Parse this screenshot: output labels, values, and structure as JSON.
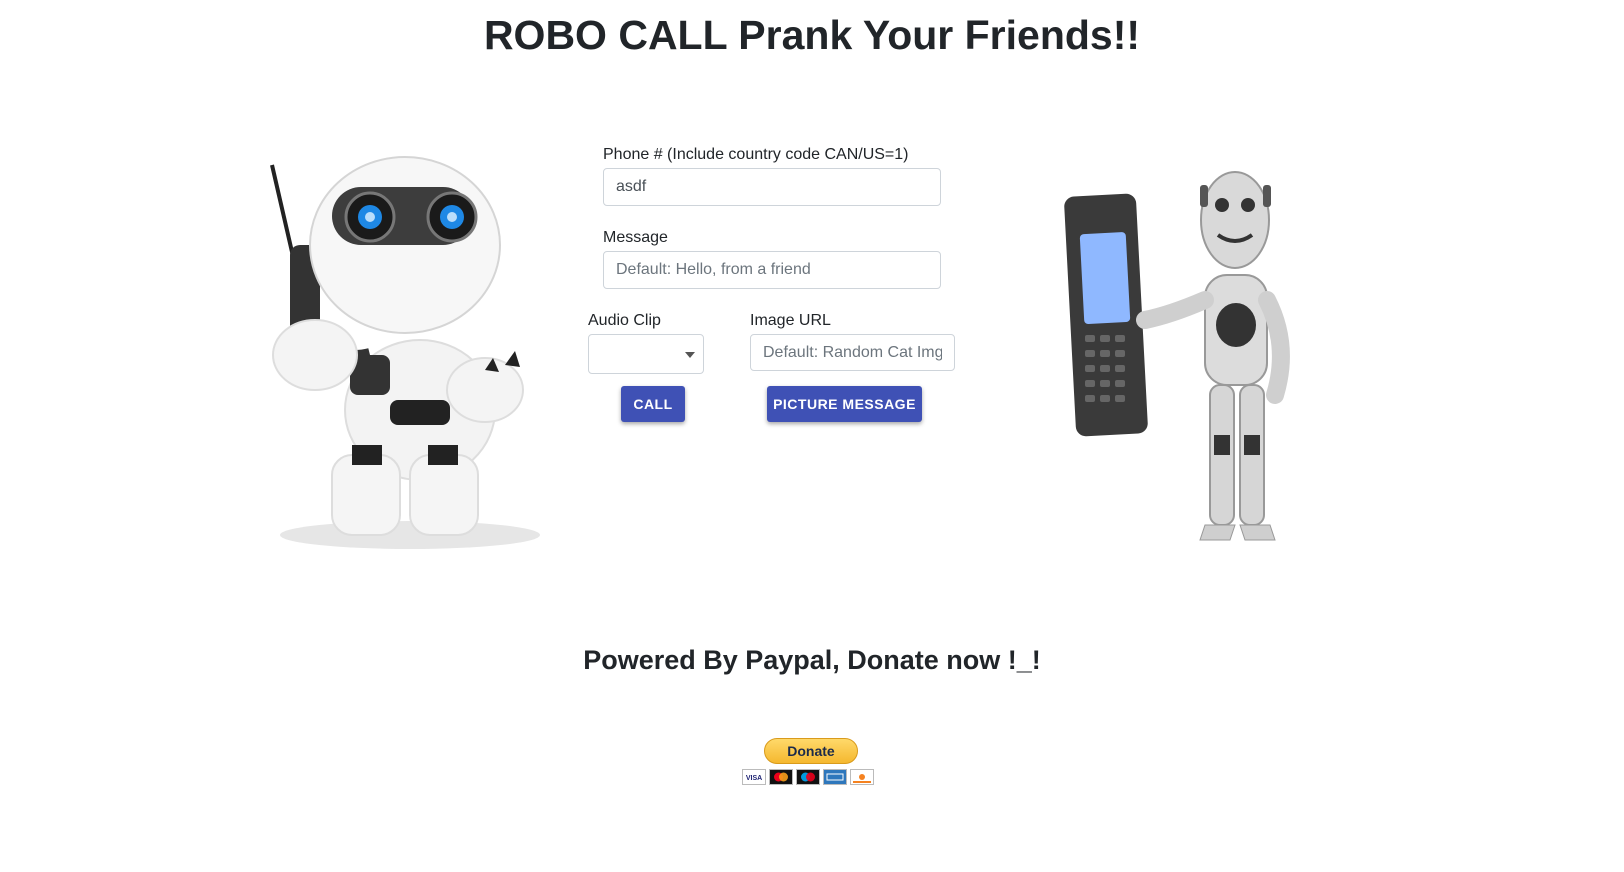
{
  "page": {
    "title": "ROBO CALL Prank Your Friends!!"
  },
  "form": {
    "phone_label": "Phone # (Include country code CAN/US=1)",
    "phone_value": "asdf",
    "message_label": "Message",
    "message_placeholder": "Default: Hello, from a friend",
    "audio_label": "Audio Clip",
    "audio_value": "",
    "image_label": "Image URL",
    "image_placeholder": "Default: Random Cat Img",
    "call_button": "CALL",
    "picture_button": "PICTURE MESSAGE"
  },
  "donate": {
    "heading": "Powered By Paypal, Donate now !_!",
    "button_label": "Donate",
    "cards": [
      "visa",
      "mastercard",
      "maestro",
      "amex",
      "discover"
    ]
  },
  "colors": {
    "accent": "#3f51b5",
    "paypal_button": "#ffc439",
    "text": "#212529"
  }
}
